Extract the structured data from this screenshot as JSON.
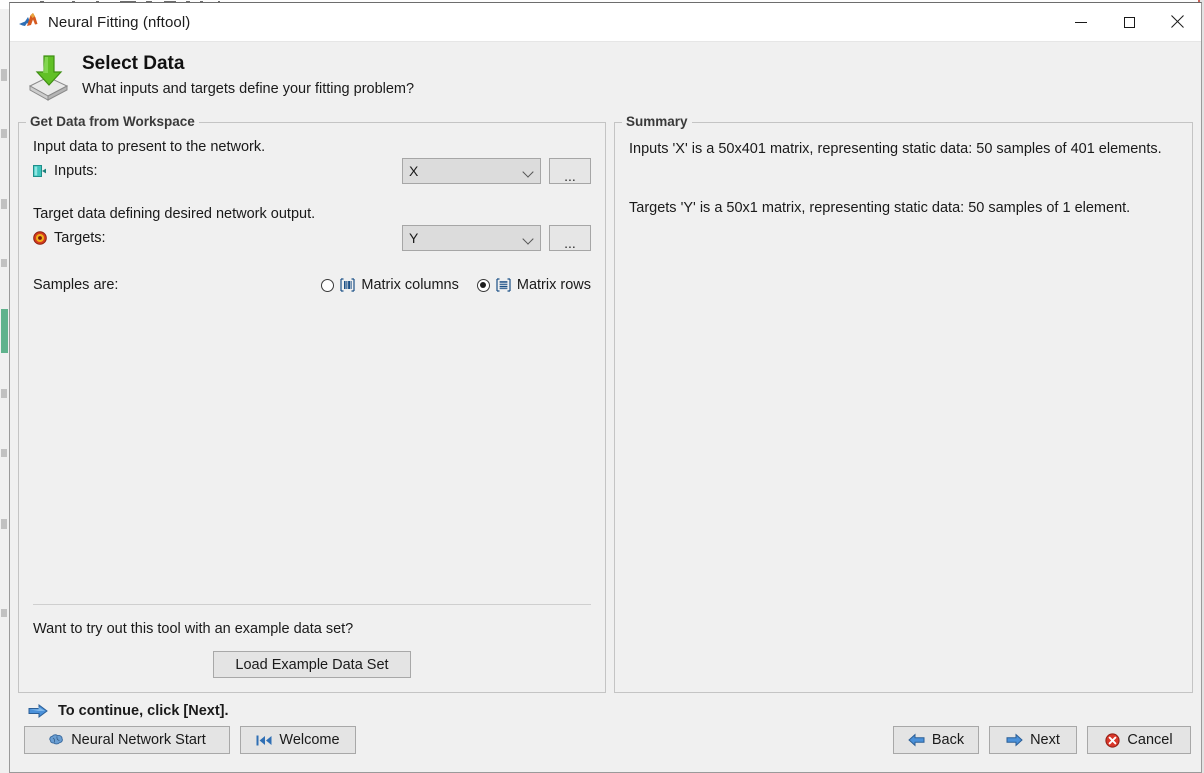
{
  "window": {
    "title": "Neural Fitting (nftool)",
    "app_icon": "matlab-logo-icon",
    "controls": {
      "minimize": "minimize-icon",
      "maximize": "maximize-icon",
      "close": "close-icon"
    }
  },
  "header": {
    "icon": "import-data-icon",
    "title": "Select Data",
    "subtitle": "What inputs and targets define your fitting problem?"
  },
  "left_panel": {
    "title": "Get Data from Workspace",
    "input_description": "Input data to present to the network.",
    "inputs": {
      "icon": "inputs-icon",
      "label": "Inputs:",
      "value": "X",
      "browse_label": "...",
      "chevron": "chevron-down-icon"
    },
    "target_description": "Target data defining desired network output.",
    "targets": {
      "icon": "targets-icon",
      "label": "Targets:",
      "value": "Y",
      "browse_label": "...",
      "chevron": "chevron-down-icon"
    },
    "samples_label": "Samples are:",
    "samples_options": [
      {
        "label": "Matrix columns",
        "icon": "matrix-columns-icon",
        "selected": false
      },
      {
        "label": "Matrix rows",
        "icon": "matrix-rows-icon",
        "selected": true
      }
    ],
    "example_question": "Want to try out this tool with an example data set?",
    "load_example_label": "Load Example Data Set"
  },
  "right_panel": {
    "title": "Summary",
    "paragraphs": [
      "Inputs 'X' is a 50x401 matrix, representing static data: 50 samples of 401 elements.",
      "Targets 'Y' is a 50x1 matrix, representing static data: 50 samples of 1 element."
    ]
  },
  "footer": {
    "status_icon": "arrow-right-icon",
    "status_text": "To continue, click [Next].",
    "neural_start_label": "Neural Network Start",
    "neural_start_icon": "brain-icon",
    "welcome_label": "Welcome",
    "welcome_icon": "rewind-to-start-icon",
    "back_label": "Back",
    "back_icon": "arrow-left-icon",
    "next_label": "Next",
    "next_icon": "arrow-right-icon",
    "cancel_label": "Cancel",
    "cancel_icon": "error-circle-icon"
  },
  "colors": {
    "window_bg": "#f0f0f0",
    "titlebar_bg": "#ffffff",
    "group_border": "#c4c4c4",
    "group_title": "#3a3a3a",
    "button_bg": "#e4e4e4",
    "button_border": "#a8a8a8",
    "combo_bg": "#dcdcdc",
    "accent_blue": "#2f6fb5",
    "accent_green": "#5cb82d",
    "accent_red": "#d0342c",
    "accent_teal": "#2fb9b0"
  }
}
